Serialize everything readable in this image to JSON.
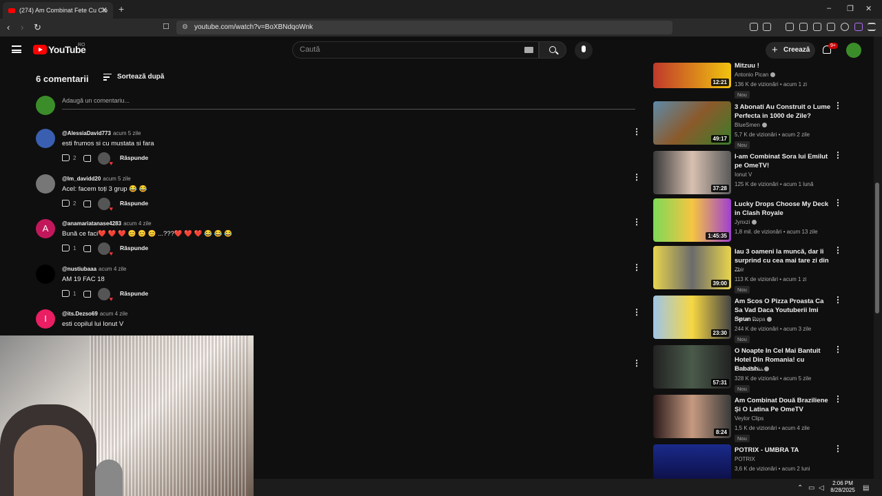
{
  "browser": {
    "tab_title": "(274) Am Combinat Fete Cu Cio",
    "url": "youtube.com/watch?v=BoXBNdqoWnk",
    "new_tab": "+",
    "close": "✕"
  },
  "youtube": {
    "logo_text": "YouTube",
    "region": "RO",
    "search_placeholder": "Caută",
    "create_label": "Creează",
    "notif_badge": "9+"
  },
  "comments": {
    "count_label": "6 comentarii",
    "sort_label": "Sortează după",
    "add_placeholder": "Adaugă un comentariu...",
    "reply_label": "Răspunde",
    "items": [
      {
        "user": "@AlessiaDavid773",
        "time": "acum 5 zile",
        "text": "esti frumos si cu mustata si fara",
        "likes": "2",
        "avatar_color": "#3a5fb0",
        "initial": ""
      },
      {
        "user": "@Im_davidd20",
        "time": "acum 5 zile",
        "text": "Acel: facem toți 3 grup 😂 😂",
        "likes": "2",
        "avatar_color": "#777777",
        "initial": ""
      },
      {
        "user": "@anamariatanase4283",
        "time": "acum 4 zile",
        "text": "Bună ce faci❤️ ❤️ ❤️ 😊 😊 😊  ...???❤️ ❤️ ❤️ 😂 😂 😂",
        "likes": "1",
        "avatar_color": "#c2185b",
        "initial": "A"
      },
      {
        "user": "@nustiubaaa",
        "time": "acum 4 zile",
        "text": "AM 19 FAC 18",
        "likes": "1",
        "avatar_color": "#000000",
        "initial": ""
      },
      {
        "user": "@its.Dezso69",
        "time": "acum 4 zile",
        "text": "esti copilul lui Ionut V",
        "likes": "",
        "avatar_color": "#e91e63",
        "initial": "I"
      }
    ]
  },
  "sidebar": {
    "videos": [
      {
        "title": "Mitzuu !",
        "channel": "Antonio Pican",
        "verified": true,
        "meta": "136 K de vizionări • acum 1 zi",
        "duration": "12:21",
        "new": "Nou",
        "thumb": "linear-gradient(90deg,#c0392b,#f1c40f)"
      },
      {
        "title": "3 Abonati Au Construit o Lume Perfecta in 1000 de Zile?",
        "channel": "BlueSmen",
        "verified": true,
        "meta": "5,7 K de vizionări • acum 2 zile",
        "duration": "49:17",
        "new": "Nou",
        "thumb": "linear-gradient(135deg,#5d8aa8,#8b5a2b,#3b7d2a)"
      },
      {
        "title": "I-am Combinat Sora lui Emilut pe OmeTV!",
        "channel": "Ionut V",
        "verified": false,
        "meta": "125 K de vizionări • acum 1 lună",
        "duration": "37:28",
        "new": "",
        "thumb": "linear-gradient(90deg,#3a3a3a,#d8c0b0,#5a5a5a)"
      },
      {
        "title": "Lucky Drops Choose My Deck in Clash Royale",
        "channel": "Jynxzi",
        "verified": true,
        "meta": "1,8 mil. de vizionări • acum 13 zile",
        "duration": "1:45:35",
        "new": "",
        "thumb": "linear-gradient(90deg,#7ed957,#f5c542,#a040d0)"
      },
      {
        "title": "Iau 3 oameni la muncă, dar îi surprind cu cea mai tare zi din ...",
        "channel": "Zbir",
        "verified": false,
        "meta": "113 K de vizionări • acum 1 zi",
        "duration": "39:00",
        "new": "Nou",
        "thumb": "linear-gradient(90deg,#e8d44d,#6b6b6b,#e8d44d)"
      },
      {
        "title": "Am Scos O Pizza Proasta Ca Sa Vad Daca Youtuberii Imi Spun ...",
        "channel": "Dorian Popa",
        "verified": true,
        "meta": "244 K de vizionări • acum 3 zile",
        "duration": "23:30",
        "new": "Nou",
        "thumb": "linear-gradient(90deg,#9fc5e8,#f6d743,#444)"
      },
      {
        "title": "O Noapte In Cel Mai Bantuit Hotel Din Romania! cu Babash...",
        "channel": "Theo Zeciu",
        "verified": true,
        "meta": "328 K de vizionări • acum 5 zile",
        "duration": "57:31",
        "new": "Nou",
        "thumb": "linear-gradient(90deg,#222,#4a5a4a,#222)"
      },
      {
        "title": "Am Combinat Două Braziliene Și O Latina Pe OmeTV",
        "channel": "Veylor Clips",
        "verified": false,
        "meta": "1,5 K de vizionări • acum 4 zile",
        "duration": "8:24",
        "new": "Nou",
        "thumb": "linear-gradient(90deg,#2a1a1a,#c79a80,#3a3a3a)"
      },
      {
        "title": "POTRIX - UMBRA TA",
        "channel": "POTRIX",
        "verified": false,
        "meta": "3,6 K de vizionări • acum 2 luni",
        "duration": "",
        "new": "",
        "thumb": "linear-gradient(180deg,#1a2a8a,#0a0a3a)"
      }
    ]
  },
  "taskbar": {
    "time": "2:06 PM",
    "date": "8/28/2025"
  },
  "icons": {
    "back": "‹",
    "forward": "›",
    "reload": "↻",
    "kebab": "⋮",
    "plus": "+"
  }
}
